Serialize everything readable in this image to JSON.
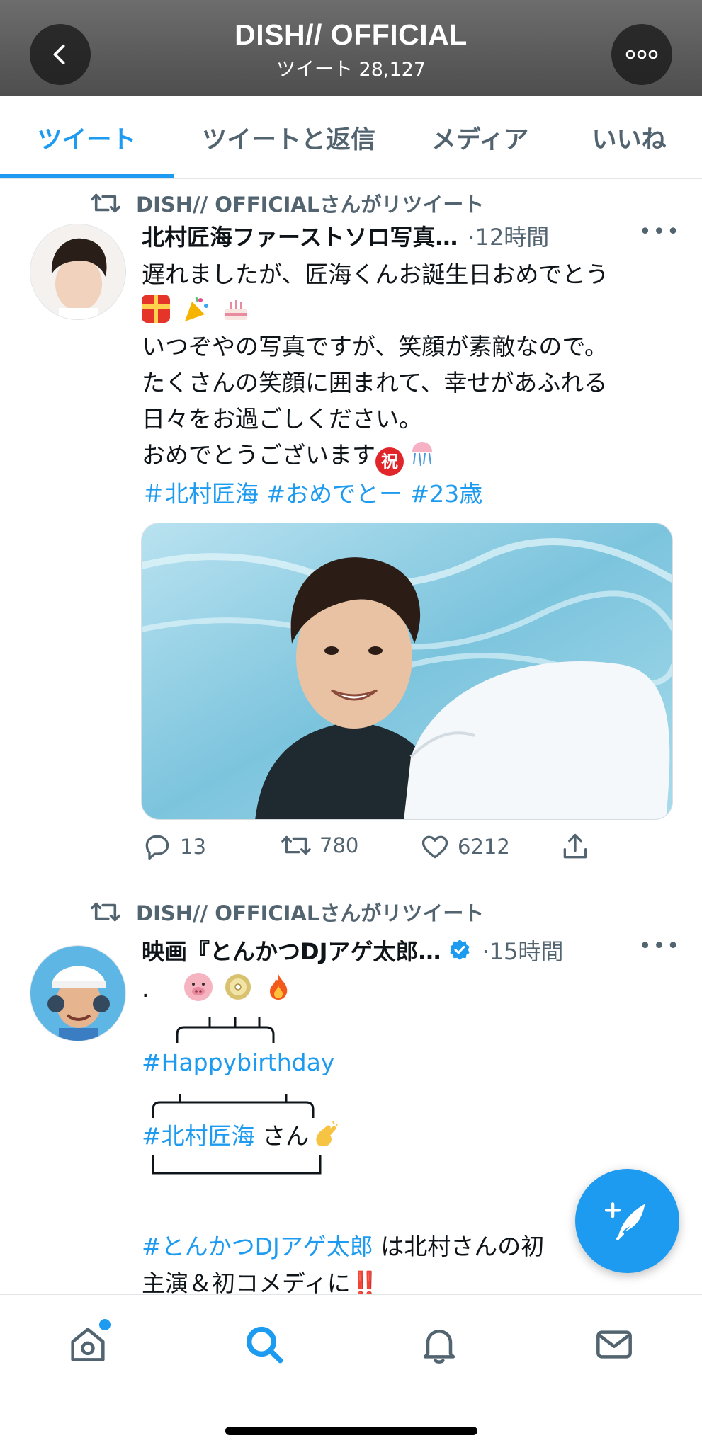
{
  "header": {
    "title": "DISH// OFFICIAL",
    "subtitle": "ツイート 28,127",
    "back_icon": "chevron-left-icon",
    "more_icon": "more-icon"
  },
  "tabs": [
    {
      "label": "ツイート",
      "active": true
    },
    {
      "label": "ツイートと返信",
      "active": false
    },
    {
      "label": "メディア",
      "active": false
    },
    {
      "label": "いいね",
      "active": false
    }
  ],
  "tweets": [
    {
      "retweet_label": "DISH// OFFICIALさんがリツイート",
      "author_name": "北村匠海ファーストソロ写真…",
      "verified": false,
      "time": "·12時間",
      "more": "•••",
      "lines": [
        "遅れましたが、匠海くんお誕生日おめでとう",
        "いつぞやの写真ですが、笑顔が素敵なので。",
        "たくさんの笑顔に囲まれて、幸せがあふれる",
        "日々をお過ごしください。",
        "おめでとうございます"
      ],
      "hashtags": [
        "＃北村匠海",
        "#おめでとー",
        "#23歳"
      ],
      "emojis_line2": [
        "gift",
        "party-popper",
        "cake"
      ],
      "emojis_line6": [
        "celebration-kanji",
        "confetti-ball"
      ],
      "celebration_glyph": "祝",
      "stats": {
        "replies": "13",
        "retweets": "780",
        "likes": "6212"
      }
    },
    {
      "retweet_label": "DISH// OFFICIALさんがリツイート",
      "author_name": "映画『とんかつDJアゲ太郎…",
      "verified": true,
      "time": "·15時間",
      "more": "•••",
      "line1_prefix": ".",
      "emojis_line1": [
        "pig-face",
        "disc",
        "fire"
      ],
      "hashtag_birthday": "#Happybirthday",
      "hashtag_name": "#北村匠海",
      "name_suffix": " さん",
      "hashtag_movie": "#とんかつDJアゲ太郎",
      "movie_suffix": " は北村さんの初",
      "last_line": "主演＆初コメディに",
      "exclaim": "‼️"
    }
  ],
  "fab": {
    "icon": "compose-tweet-icon"
  },
  "bottom_nav": [
    {
      "name": "home",
      "icon": "home-icon",
      "has_dot": true
    },
    {
      "name": "search",
      "icon": "search-icon",
      "active": true
    },
    {
      "name": "notifications",
      "icon": "bell-icon"
    },
    {
      "name": "messages",
      "icon": "mail-icon"
    }
  ],
  "colors": {
    "accent": "#1d9bf0",
    "secondary_text": "#536471",
    "primary_text": "#0f1419"
  }
}
